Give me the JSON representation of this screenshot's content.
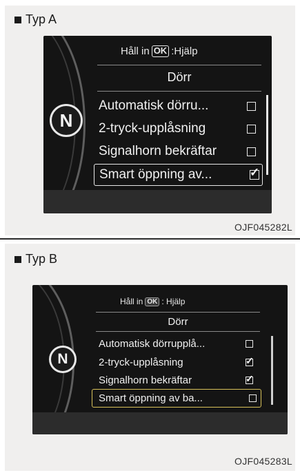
{
  "panel_a": {
    "heading": "Typ A",
    "hint_prefix": "Håll in",
    "hint_key": "OK",
    "hint_suffix": ":Hjälp",
    "menu_title": "Dörr",
    "gear": "N",
    "items": [
      {
        "label": "Automatisk dörru...",
        "checked": false
      },
      {
        "label": "2-tryck-upplåsning",
        "checked": false
      },
      {
        "label": "Signalhorn bekräftar",
        "checked": false
      },
      {
        "label": "Smart öppning av...",
        "checked": true
      }
    ],
    "image_code": "OJF045282L"
  },
  "panel_b": {
    "heading": "Typ B",
    "hint_prefix": "Håll in",
    "hint_key": "OK",
    "hint_suffix": ": Hjälp",
    "menu_title": "Dörr",
    "gear": "N",
    "items": [
      {
        "label": "Automatisk dörrupplå...",
        "checked": false
      },
      {
        "label": "2-tryck-upplåsning",
        "checked": true
      },
      {
        "label": "Signalhorn bekräftar",
        "checked": true
      },
      {
        "label": "Smart öppning av ba...",
        "checked": false
      }
    ],
    "image_code": "OJF045283L"
  },
  "colors": {
    "selection_a": "#e8e8e8",
    "selection_b": "#d9c25a",
    "screen_bg": "#141414"
  },
  "icons": {
    "checkbox_checked": "checkmark-box",
    "checkbox_empty": "empty-box",
    "gear_indicator": "neutral-gear-N"
  }
}
